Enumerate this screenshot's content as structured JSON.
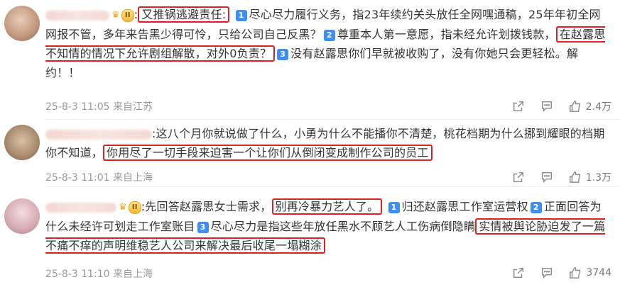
{
  "comments": [
    {
      "badge": "II",
      "parts": [
        {
          "t": ":",
          "hl": false
        },
        {
          "t": "又推锅逃避责任:",
          "hl": true
        },
        {
          "t": " ",
          "hl": false
        },
        {
          "num": "1"
        },
        {
          "t": "尽心尽力履行义务，指23年续约关头放任全网嘿通稿，25年年初全网网报不管，多年来告黑少得可怜，只给公司自己反黑？",
          "hl": false
        },
        {
          "num": "2"
        },
        {
          "t": "尊重本人第一意愿，指未经允许划拨钱款，",
          "hl": false
        },
        {
          "t": "在赵露思不知情的情况下允许剧组解散，对外0负责？",
          "hl": true
        },
        {
          "num": "3"
        },
        {
          "t": "没有赵露思你们早就被收购了，没有你她只会更轻松。解约！！",
          "hl": false
        }
      ],
      "meta": "25-8-3 11:05 来自江苏",
      "likes": "2.4万"
    },
    {
      "badge": "",
      "parts": [
        {
          "t": ":这八个月你就说做了什么，小勇为什么不能播你不清楚，桃花档期为什么挪到耀眼的档期你不知道，",
          "hl": false
        },
        {
          "t": "你用尽了一切手段来迫害一个让你们从倒闭变成制作公司的员工",
          "hl": true
        }
      ],
      "meta": "25-8-3 11:01 来自上海",
      "likes": "1.3万"
    },
    {
      "badge": "II",
      "parts": [
        {
          "t": ":先回答赵露思女士需求，",
          "hl": false
        },
        {
          "t": "别再冷暴力艺人了。",
          "hl": true
        },
        {
          "t": " ",
          "hl": false
        },
        {
          "num": "1"
        },
        {
          "t": "归还赵露思工作室运营权",
          "hl": false
        },
        {
          "num": "2"
        },
        {
          "t": "正面回答为什么未经许可划走工作室账目",
          "hl": false
        },
        {
          "num": "3"
        },
        {
          "t": "尽心尽力是指这些年放任黑水不顾艺人工伤病倒隐瞒",
          "hl": false
        },
        {
          "t": "实情被舆论胁迫发了一篇不痛不痒的声明维稳艺人公司来解决最后收尾一塌糊涂",
          "hl": true
        }
      ],
      "meta": "25-8-3 11:10 来自上海",
      "likes": "3744"
    }
  ]
}
